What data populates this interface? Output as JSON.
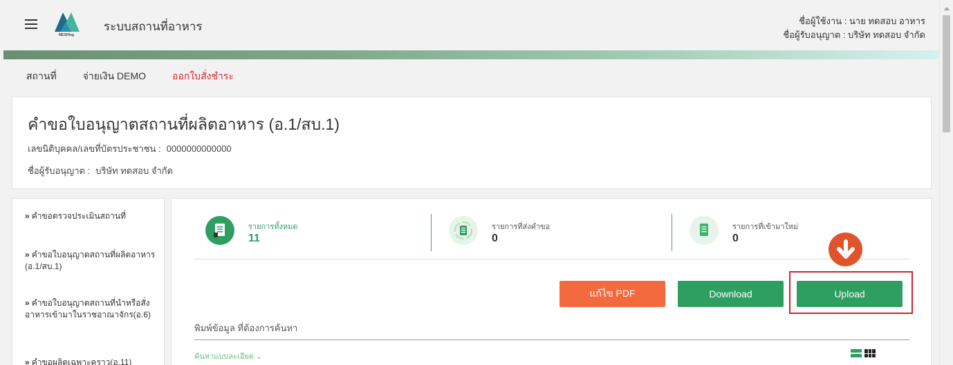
{
  "header": {
    "app_title": "ระบบสถานที่อาหาร",
    "logo_text": "MESHlog",
    "user_line": "ชื่อผู้ใช้งาน : นาย ทดสอบ อาหาร",
    "licensee_line": "ชื่อผู้รับอนุญาต : บริษัท ทดสอบ จำกัด"
  },
  "topnav": {
    "items": [
      "สถานที่",
      "จ่ายเงิน DEMO",
      "ออกใบสั่งชำระ"
    ]
  },
  "info": {
    "title": "คำขอใบอนุญาตสถานที่ผลิตอาหาร (อ.1/สบ.1)",
    "id_label": "เลขนิติบุคคล/เลขที่บัตรประชาชน :",
    "id_value": "0000000000000",
    "licensee_label": "ชื่อผู้รับอนุญาต :",
    "licensee_value": "บริษัท ทดสอบ จำกัด"
  },
  "sidebar": {
    "items": [
      "คำขอตรวจประเมินสถานที่",
      "คำขอใบอนุญาตสถานที่ผลิตอาหาร (อ.1/สบ.1)",
      "คำขอใบอนุญาตสถานที่นำหรือสั่งอาหารเข้ามาในราชอาณาจักร(อ.6)",
      "คำขอผลิตเฉพาะคราว(อ.11)"
    ]
  },
  "stats": [
    {
      "label": "รายการทั้งหมด",
      "value": "11",
      "label_color": "#2e9e61",
      "icon_bg": "#2e9e61"
    },
    {
      "label": "รายการที่ส่งคำขอ",
      "value": "0",
      "label_color": "#555555",
      "icon_bg": "#e8f4ea"
    },
    {
      "label": "รายการที่เข้ามาใหม่",
      "value": "0",
      "label_color": "#555555",
      "icon_bg": "#e8f4ea"
    }
  ],
  "actions": {
    "edit_pdf": "แก้ไข PDF",
    "download": "Download",
    "upload": "Upload"
  },
  "search": {
    "label": "พิมพ์ข้อมูล ที่ต้องการค้นหา",
    "placeholder": "",
    "advanced": "ค้นหาแบบละเอียด ⌄"
  },
  "colors": {
    "primary_green": "#2e9e61",
    "orange": "#f46a3f",
    "active_nav": "#e0262e",
    "highlight": "#c9252c"
  },
  "icons": [
    "menu-icon",
    "meshlog-logo",
    "document-icon",
    "refresh-document-icon",
    "new-document-icon",
    "down-arrow-icon",
    "list-view-icon",
    "grid-view-icon"
  ]
}
